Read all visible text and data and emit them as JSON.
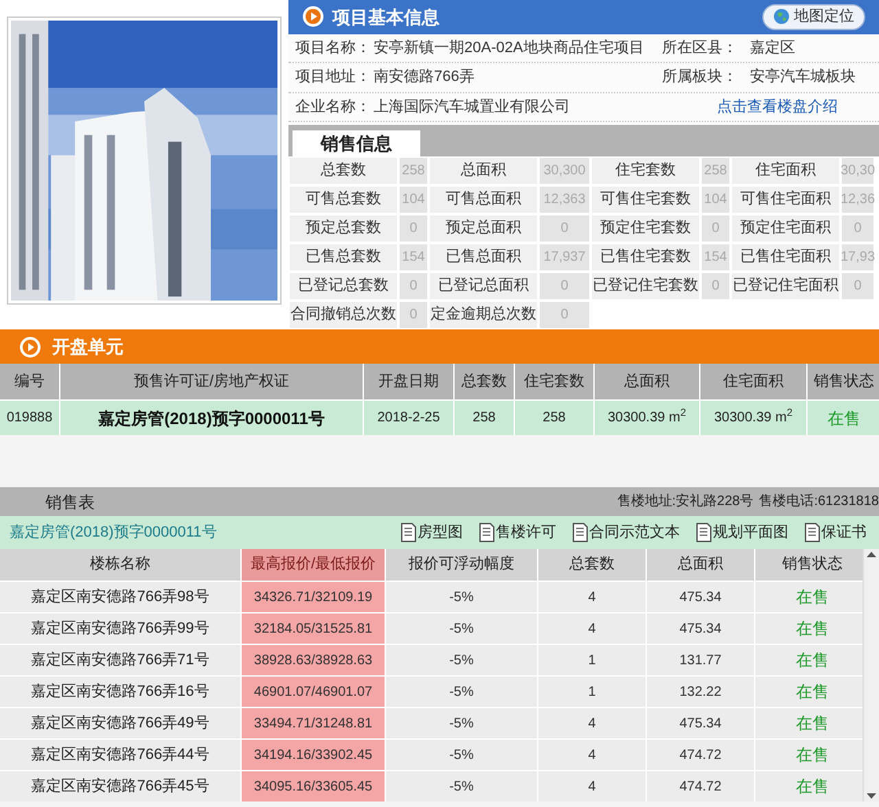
{
  "project": {
    "title": "项目基本信息",
    "map_button": "地图定位",
    "rows": [
      {
        "left": {
          "label": "项目名称：",
          "value": "安亭新镇一期20A-02A地块商品住宅项目"
        },
        "right": {
          "kind": "field",
          "label": "所在区县：",
          "value": "嘉定区"
        }
      },
      {
        "left": {
          "label": "项目地址：",
          "value": "南安德路766弄"
        },
        "right": {
          "kind": "field",
          "label": "所属板块：",
          "value": "安亭汽车城板块"
        }
      },
      {
        "left": {
          "label": "企业名称：",
          "value": "上海国际汽车城置业有限公司"
        },
        "right": {
          "kind": "link",
          "value": "点击查看楼盘介绍"
        }
      }
    ]
  },
  "sales_info": {
    "tab": "销售信息",
    "rows": [
      [
        "总套数",
        "258",
        "总面积",
        "30,300",
        "住宅套数",
        "258",
        "住宅面积",
        "30,30"
      ],
      [
        "可售总套数",
        "104",
        "可售总面积",
        "12,363",
        "可售住宅套数",
        "104",
        "可售住宅面积",
        "12,36"
      ],
      [
        "预定总套数",
        "0",
        "预定总面积",
        "0",
        "预定住宅套数",
        "0",
        "预定住宅面积",
        "0"
      ],
      [
        "已售总套数",
        "154",
        "已售总面积",
        "17,937",
        "已售住宅套数",
        "154",
        "已售住宅面积",
        "17,93"
      ],
      [
        "已登记总套数",
        "0",
        "已登记总面积",
        "0",
        "已登记住宅套数",
        "0",
        "已登记住宅面积",
        "0"
      ],
      [
        "合同撤销总次数",
        "0",
        "定金逾期总次数",
        "0"
      ]
    ]
  },
  "units": {
    "title": "开盘单元",
    "columns": [
      "编号",
      "预售许可证/房地产权证",
      "开盘日期",
      "总套数",
      "住宅套数",
      "总面积",
      "住宅面积",
      "销售状态"
    ],
    "rows": [
      [
        "019888",
        "嘉定房管(2018)预字0000011号",
        "2018-2-25",
        "258",
        "258",
        "30300.39 m$^{2}$",
        "30300.39 m$^{2}$",
        "在售"
      ]
    ]
  },
  "sales_table": {
    "title": "销售表",
    "address": "售楼地址:安礼路228号",
    "phone": "售楼电话:61231818",
    "permit": "嘉定房管(2018)预字0000011号",
    "links": [
      "房型图",
      "售楼许可",
      "合同示范文本",
      "规划平面图",
      "保证书"
    ],
    "columns": [
      {
        "label": "楼栋名称",
        "highlighted": false
      },
      {
        "label": "最高报价/最低报价",
        "highlighted": true
      },
      {
        "label": "报价可浮动幅度",
        "highlighted": false
      },
      {
        "label": "总套数",
        "highlighted": false
      },
      {
        "label": "总面积",
        "highlighted": false
      },
      {
        "label": "销售状态",
        "highlighted": false
      }
    ],
    "rows": [
      [
        "嘉定区南安德路766弄98号",
        "34326.71/32109.19",
        "-5%",
        "4",
        "475.34",
        "在售"
      ],
      [
        "嘉定区南安德路766弄99号",
        "32184.05/31525.81",
        "-5%",
        "4",
        "475.34",
        "在售"
      ],
      [
        "嘉定区南安德路766弄71号",
        "38928.63/38928.63",
        "-5%",
        "1",
        "131.77",
        "在售"
      ],
      [
        "嘉定区南安德路766弄16号",
        "46901.07/46901.07",
        "-5%",
        "1",
        "132.22",
        "在售"
      ],
      [
        "嘉定区南安德路766弄49号",
        "33494.71/31248.81",
        "-5%",
        "4",
        "475.34",
        "在售"
      ],
      [
        "嘉定区南安德路766弄44号",
        "34194.16/33902.45",
        "-5%",
        "4",
        "474.72",
        "在售"
      ],
      [
        "嘉定区南安德路766弄45号",
        "34095.16/33605.45",
        "-5%",
        "4",
        "474.72",
        "在售"
      ]
    ]
  }
}
